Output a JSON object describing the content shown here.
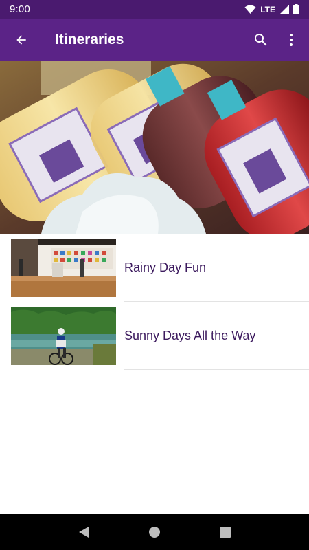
{
  "status_bar": {
    "time": "9:00",
    "network": "LTE",
    "icons": [
      "wifi-icon",
      "signal-icon",
      "battery-icon"
    ]
  },
  "app_bar": {
    "title": "Itineraries",
    "back_icon": "arrow-back-icon",
    "search_icon": "search-icon",
    "more_icon": "more-vert-icon"
  },
  "hero": {
    "image": "wine-bottles-on-ice"
  },
  "itineraries": [
    {
      "label": "Rainy Day Fun",
      "thumbnail": "art-gallery-interior"
    },
    {
      "label": "Sunny Days All the Way",
      "thumbnail": "mountain-biker-by-lake"
    }
  ],
  "nav_bar": {
    "icons": [
      "back-triangle-icon",
      "home-circle-icon",
      "recents-square-icon"
    ]
  },
  "colors": {
    "status_bar": "#4a1a6f",
    "app_bar": "#5b2387",
    "item_text": "#3c1a5e",
    "divider": "#e3e3e3"
  }
}
